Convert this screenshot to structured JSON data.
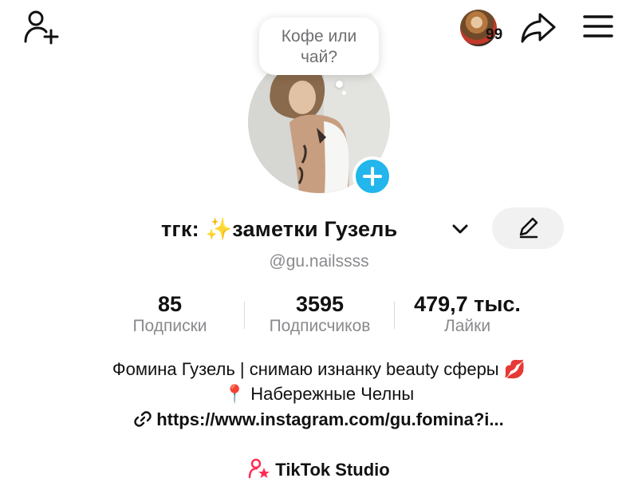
{
  "topbar": {
    "notification_count": "99"
  },
  "bubble": {
    "text": "Кофе или чай?"
  },
  "profile": {
    "display_name": "тгк: ✨заметки Гузель",
    "handle": "@gu.nailssss"
  },
  "stats": [
    {
      "value": "85",
      "label": "Подписки"
    },
    {
      "value": "3595",
      "label": "Подписчиков"
    },
    {
      "value": "479,7 тыс.",
      "label": "Лайки"
    }
  ],
  "bio": {
    "line1": "Фомина Гузель | снимаю изнанку beauty сферы 💋",
    "line2": "📍 Набережные Челны",
    "link": "https://www.instagram.com/gu.fomina?i..."
  },
  "studio": {
    "label": "TikTok Studio"
  },
  "colors": {
    "accent_blue": "#22b6ec",
    "studio_pink": "#fe2c55"
  }
}
